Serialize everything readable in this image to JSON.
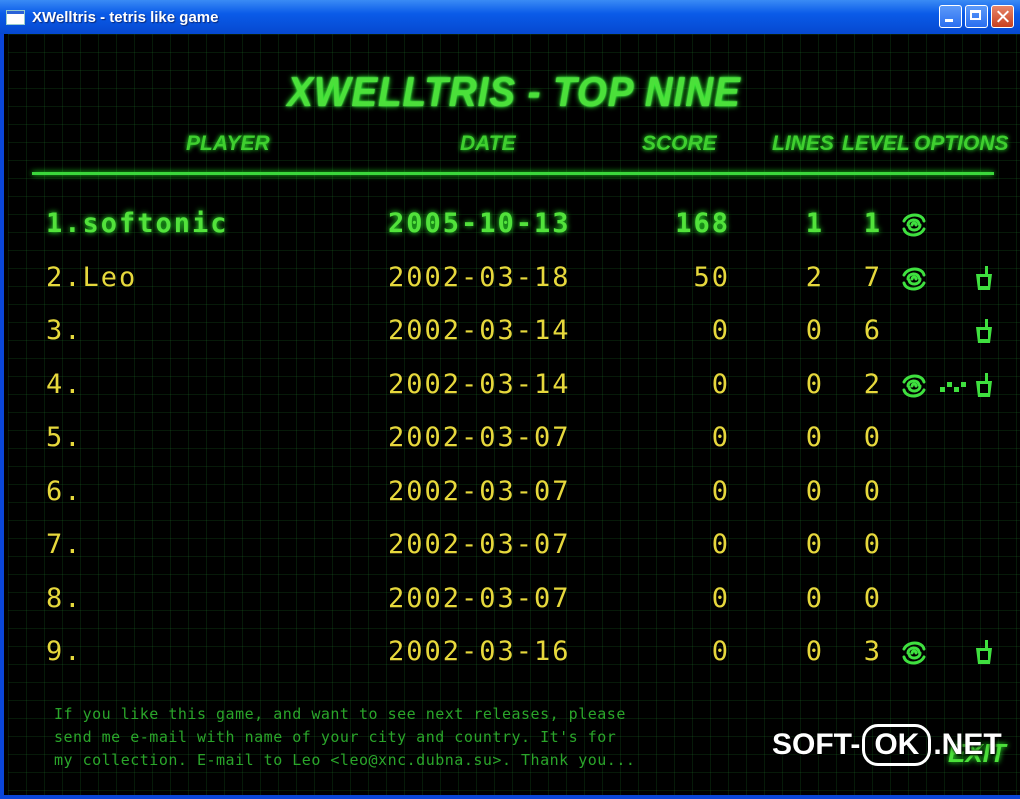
{
  "window": {
    "title": "XWelltris - tetris like game"
  },
  "heading": "XWELLTRIS - TOP NINE",
  "columns": {
    "player": "PLAYER",
    "date": "DATE",
    "score": "SCORE",
    "lines": "LINES",
    "level": "LEVEL",
    "options": "OPTIONS"
  },
  "rows": [
    {
      "player": "1.softonic",
      "date": "2005-10-13",
      "score": "168",
      "lines": "1",
      "level": "1",
      "options": [
        "swirl-icon"
      ]
    },
    {
      "player": "2.Leo",
      "date": "2002-03-18",
      "score": "50",
      "lines": "2",
      "level": "7",
      "options": [
        "swirl-icon",
        "cup-icon"
      ]
    },
    {
      "player": "3.",
      "date": "2002-03-14",
      "score": "0",
      "lines": "0",
      "level": "6",
      "options": [
        "cup-icon"
      ]
    },
    {
      "player": "4.",
      "date": "2002-03-14",
      "score": "0",
      "lines": "0",
      "level": "2",
      "options": [
        "swirl-icon",
        "dots-icon",
        "cup-icon"
      ]
    },
    {
      "player": "5.",
      "date": "2002-03-07",
      "score": "0",
      "lines": "0",
      "level": "0",
      "options": []
    },
    {
      "player": "6.",
      "date": "2002-03-07",
      "score": "0",
      "lines": "0",
      "level": "0",
      "options": []
    },
    {
      "player": "7.",
      "date": "2002-03-07",
      "score": "0",
      "lines": "0",
      "level": "0",
      "options": []
    },
    {
      "player": "8.",
      "date": "2002-03-07",
      "score": "0",
      "lines": "0",
      "level": "0",
      "options": []
    },
    {
      "player": "9.",
      "date": "2002-03-16",
      "score": "0",
      "lines": "0",
      "level": "3",
      "options": [
        "swirl-icon",
        "cup-icon"
      ]
    }
  ],
  "footer": {
    "line1": "If you like this game, and want to see next releases, please",
    "line2": "send me e-mail with name of your city and country. It's for",
    "line3": "my collection. E-mail to Leo <leo@xnc.dubna.su>. Thank you..."
  },
  "exit_label": "EXIT",
  "watermark": {
    "left": "SOFT-",
    "box": "OK",
    "right": ".NET"
  },
  "colors": {
    "accent_green": "#4be03a",
    "score_yellow": "#e6d83c",
    "titlebar_blue": "#0a5be8"
  }
}
